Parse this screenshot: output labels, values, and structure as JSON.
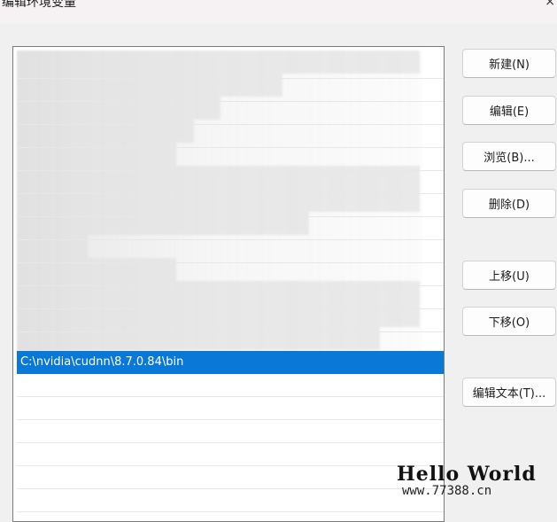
{
  "dialog": {
    "title": "编辑环境变量",
    "close_glyph": "×"
  },
  "list": {
    "selected_value": "C:\\nvidia\\cudnn\\8.7.0.84\\bin"
  },
  "buttons": {
    "new": "新建(N)",
    "edit": "编辑(E)",
    "browse": "浏览(B)...",
    "delete": "删除(D)",
    "move_up": "上移(U)",
    "move_down": "下移(O)",
    "edit_text": "编辑文本(T)..."
  },
  "watermark": {
    "main": "Hello World",
    "sub": "www.77388.cn"
  }
}
